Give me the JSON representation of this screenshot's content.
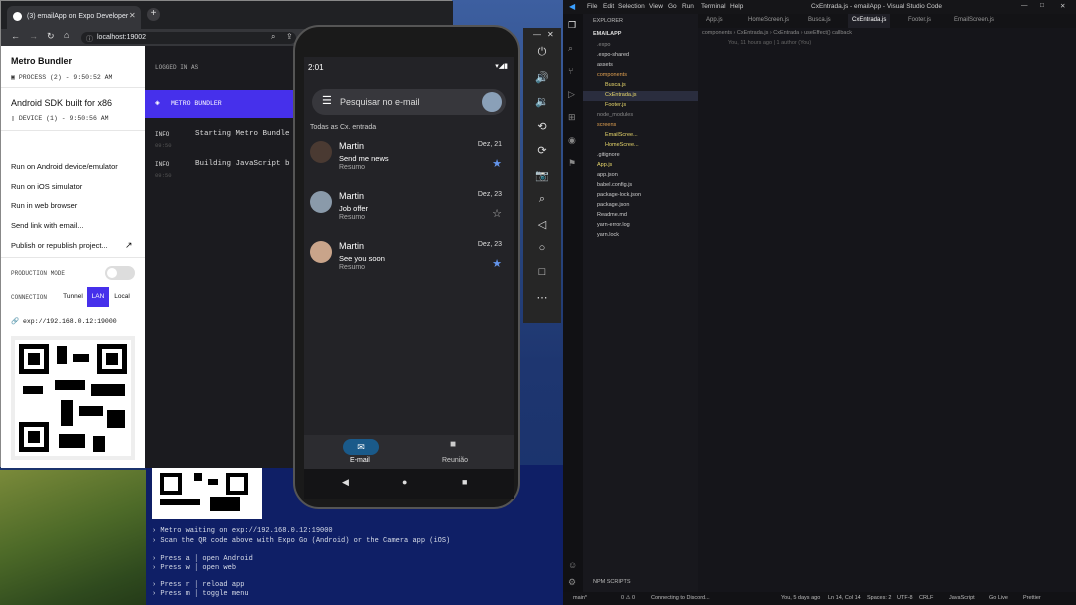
{
  "browser": {
    "tab_title": "(3) emailApp on Expo Developer",
    "url": "localhost:19002",
    "sidebar": {
      "title": "Metro Bundler",
      "process": "PROCESS (2) - 9:50:52 AM",
      "device_title": "Android SDK built for x86",
      "device": "DEVICE (1) - 9:50:56 AM",
      "menu": [
        "Run on Android device/emulator",
        "Run on iOS simulator",
        "Run in web browser",
        "Send link with email...",
        "Publish or republish project..."
      ],
      "production_mode": "PRODUCTION MODE",
      "connection": "CONNECTION",
      "conn_options": [
        "Tunnel",
        "LAN",
        "Local"
      ],
      "exp_url": "exp://192.168.0.12:19000"
    },
    "log": {
      "logged_in": "LOGGED IN AS",
      "metro_bundler": "METRO BUNDLER",
      "entries": [
        {
          "level": "INFO",
          "time": "09:50",
          "msg": "Starting Metro Bundle"
        },
        {
          "level": "INFO",
          "time": "09:50",
          "msg": "Building JavaScript b"
        }
      ]
    }
  },
  "terminal": {
    "lines": [
      "› Metro waiting on exp://192.168.0.12:19000",
      "› Scan the QR code above with Expo Go (Android) or the Camera app (iOS)",
      "",
      "› Press a │ open Android",
      "› Press w │ open web",
      "",
      "› Press r │ reload app",
      "› Press m │ toggle menu"
    ]
  },
  "phone": {
    "time": "2:01",
    "search_placeholder": "Pesquisar no e-mail",
    "section": "Todas as Cx. entrada",
    "emails": [
      {
        "sender": "Martin",
        "subject": "Send me news",
        "summary": "Resumo",
        "date": "Dez, 21",
        "starred": true
      },
      {
        "sender": "Martin",
        "subject": "Job offer",
        "summary": "Resumo",
        "date": "Dez, 23",
        "starred": false
      },
      {
        "sender": "Martin",
        "subject": "See you soon",
        "summary": "Resumo",
        "date": "Dez, 23",
        "starred": true
      }
    ],
    "nav": [
      "E-mail",
      "Reunião"
    ]
  },
  "vscode": {
    "title": "CxEntrada.js - emailApp - Visual Studio Code",
    "menu": [
      "File",
      "Edit",
      "Selection",
      "View",
      "Go",
      "Run",
      "Terminal",
      "Help"
    ],
    "tabs": [
      "App.js",
      "HomeScreen.js",
      "Busca.js",
      "CxEntrada.js",
      "Footer.js",
      "EmailScreen.js"
    ],
    "explorer_title": "EXPLORER",
    "project": "EMAILAPP",
    "breadcrumb": "components › CxEntrada.js › CxEntrada › useEffect() callback",
    "blame": "You, 11 hours ago | 1 author (You)",
    "files": [
      ".expo",
      ".expo-shared",
      "assets",
      "components",
      "Busca.js",
      "CxEntrada.js",
      "Footer.js",
      "node_modules",
      "screens",
      "EmailScree...",
      "HomeScree...",
      ".gitignore",
      "App.js",
      "app.json",
      "babel.config.js",
      "package-lock.json",
      "package.json",
      "Readme.md",
      "yarn-error.log",
      "yarn.lock"
    ],
    "npm_scripts": "NPM SCRIPTS",
    "status": {
      "branch": "main*",
      "errors": "0 ⚠ 0",
      "discord": "Connecting to Discord...",
      "blame": "You, 5 days ago",
      "position": "Ln 14, Col 14",
      "spaces": "Spaces: 2",
      "encoding": "UTF-8",
      "eol": "CRLF",
      "language": "JavaScript",
      "golive": "Go Live",
      "prettier": "Prettier"
    }
  }
}
